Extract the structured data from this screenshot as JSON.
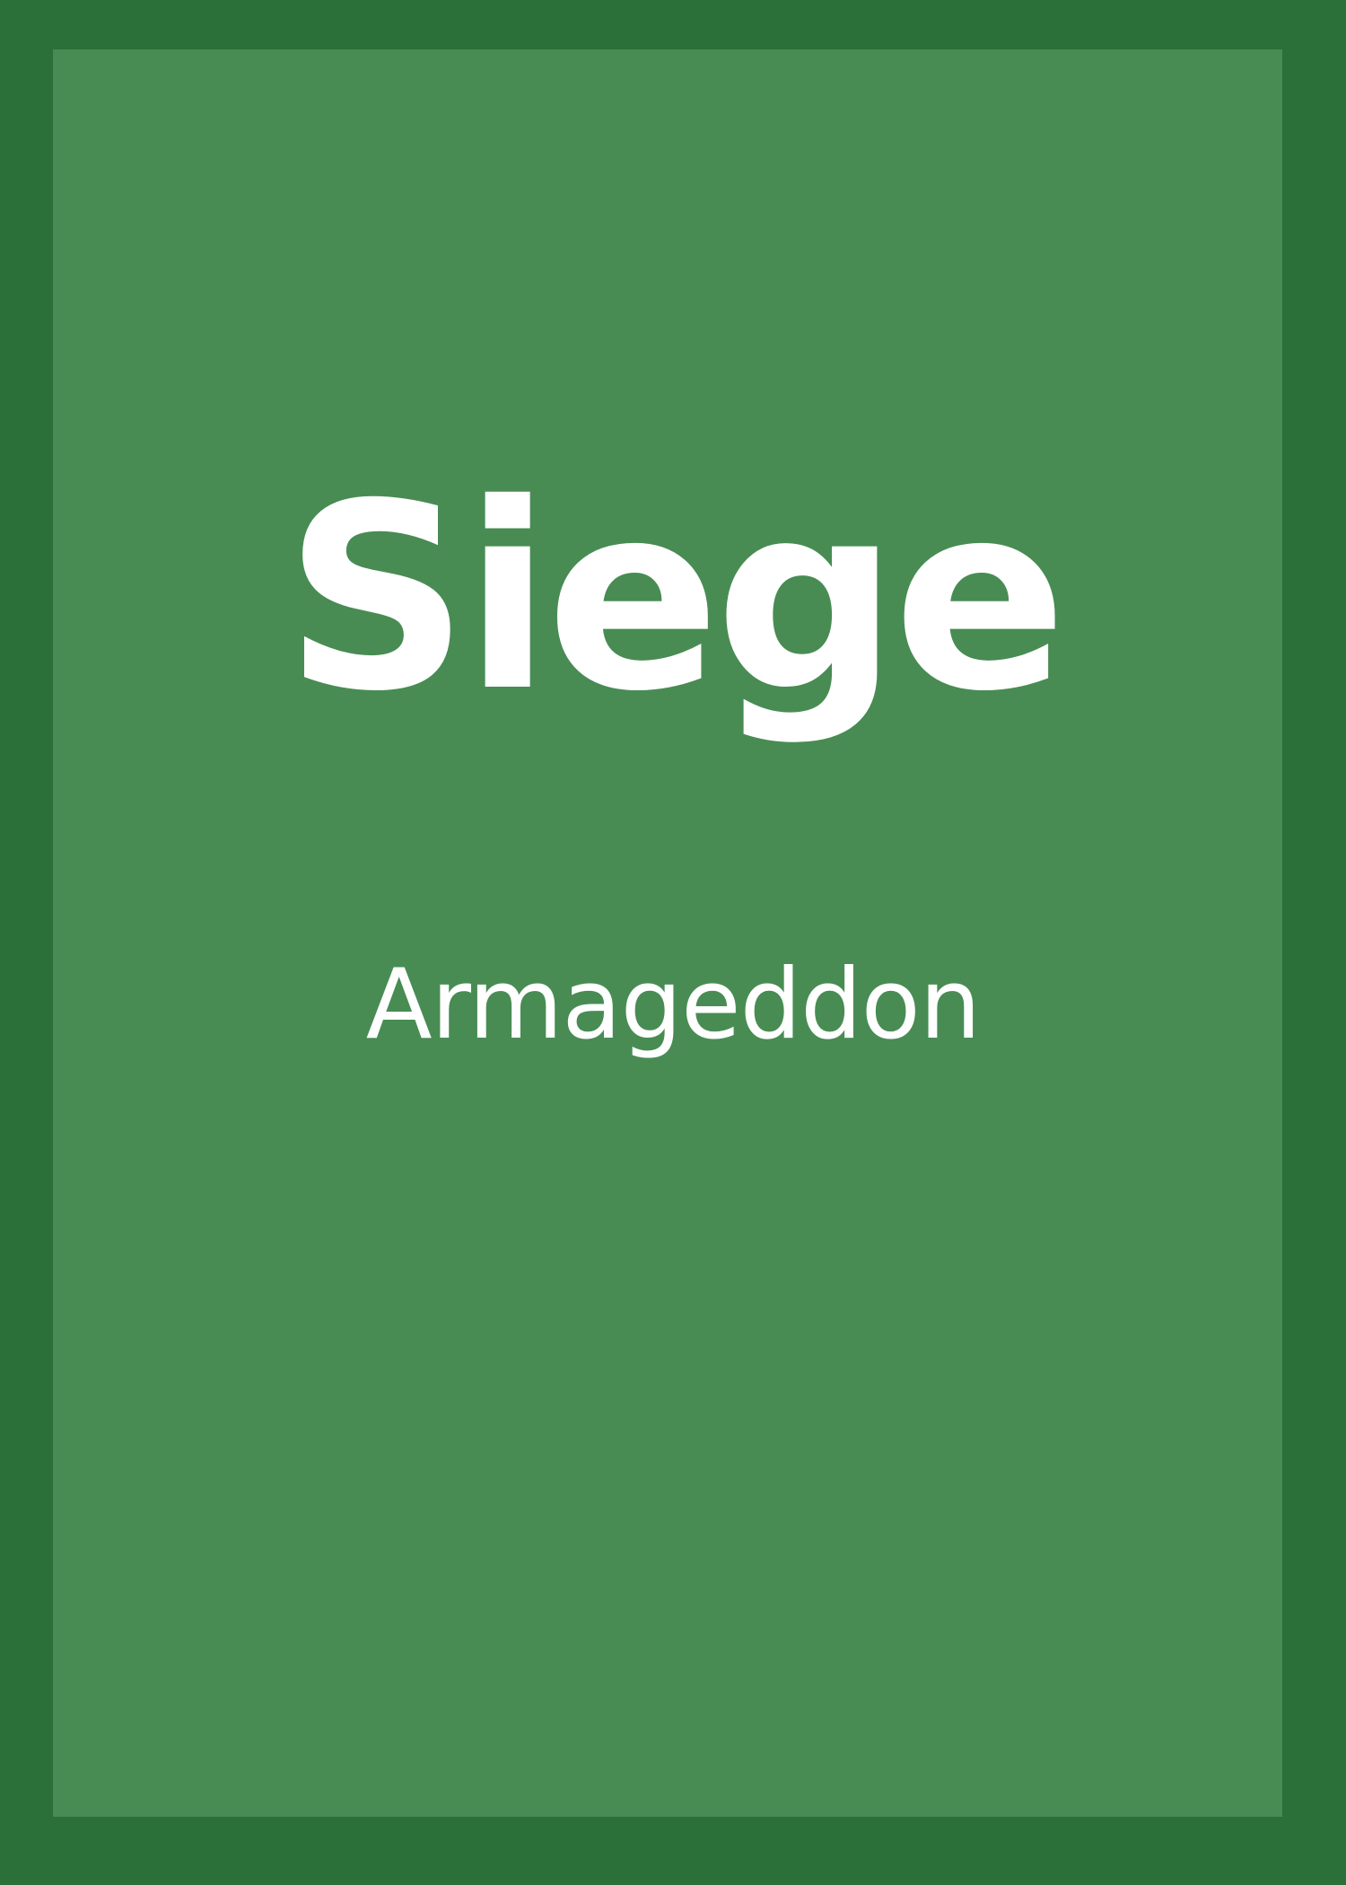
{
  "cover": {
    "title": "Siege",
    "subtitle": "Armageddon",
    "colors": {
      "border": "#2b7038",
      "panel": "#488c54",
      "text": "#ffffff"
    }
  }
}
